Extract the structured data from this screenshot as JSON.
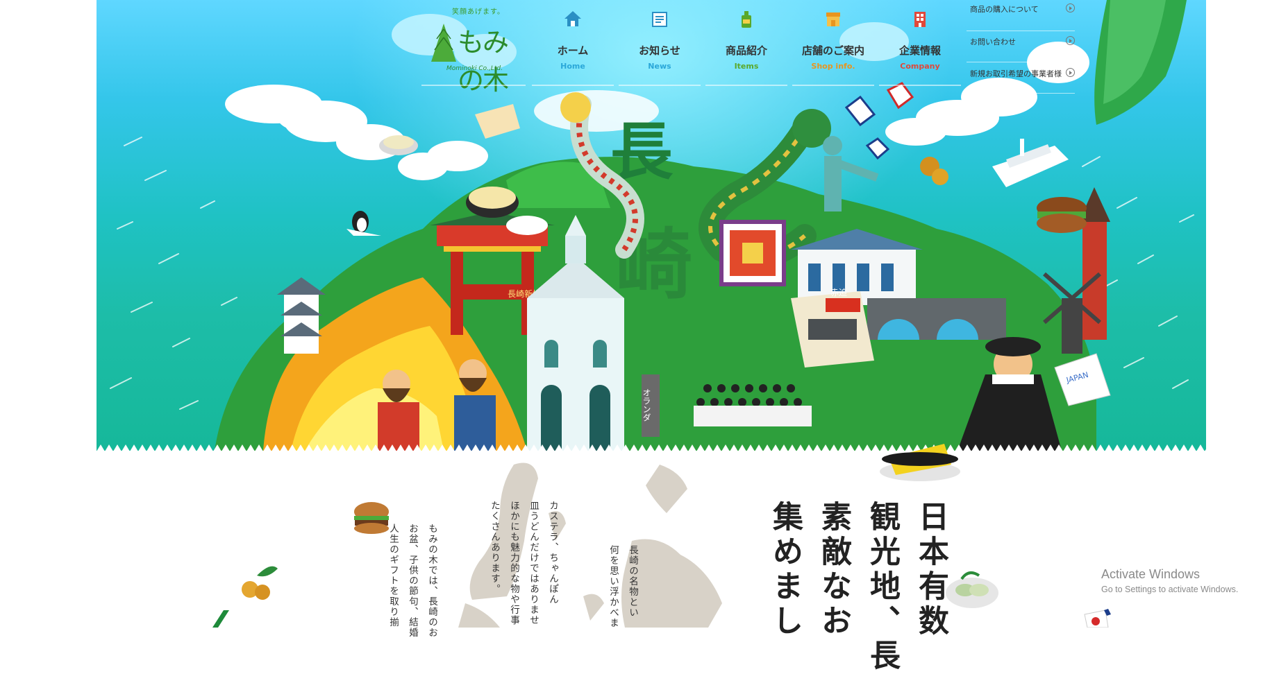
{
  "header": {
    "tagline": "笑顔あげます。",
    "logo_text": "もみの木",
    "logo_sub": "Mominoki Co.,Ltd."
  },
  "nav": {
    "items": [
      {
        "label": "ホーム",
        "sub": "Home",
        "color": "#2aa7d9",
        "icon": "house-icon"
      },
      {
        "label": "お知らせ",
        "sub": "News",
        "color": "#2aa7d9",
        "icon": "newspaper-icon"
      },
      {
        "label": "商品紹介",
        "sub": "Items",
        "color": "#5aa82a",
        "icon": "bottle-icon"
      },
      {
        "label": "店舗のご案内",
        "sub": "Shop info.",
        "color": "#e8951f",
        "icon": "shop-icon"
      },
      {
        "label": "企業情報",
        "sub": "Company",
        "color": "#e0483a",
        "icon": "building-icon"
      }
    ]
  },
  "side_links": [
    {
      "label": "商品の購入について"
    },
    {
      "label": "お問い合わせ"
    },
    {
      "label": "新規お取引希望の事業者様"
    }
  ],
  "hero": {
    "kanji_top": "長",
    "kanji_bottom": "崎",
    "sign_text": "長崎新地中華街",
    "tram_text": "赤迫",
    "pillar_text": "オランダ",
    "flag_text": "JAPAN"
  },
  "intro": {
    "heading_lines": [
      "日本有数",
      "観光地、長",
      "素敵なお",
      "集めまし"
    ],
    "para1": [
      "長崎の名物とい",
      "何を思い浮かべま"
    ],
    "para2": [
      "カステラ、ちゃんぽん",
      "皿うどんだけではありませ",
      "ほかにも魅力的な物や行事",
      "たくさんあります。"
    ],
    "para3": [
      "もみの木では、長崎のお",
      "お盆、子供の節句、結婚",
      "人生のギフトを取り揃"
    ]
  },
  "os_overlay": {
    "title": "Activate Windows",
    "subtitle": "Go to Settings to activate Windows."
  }
}
